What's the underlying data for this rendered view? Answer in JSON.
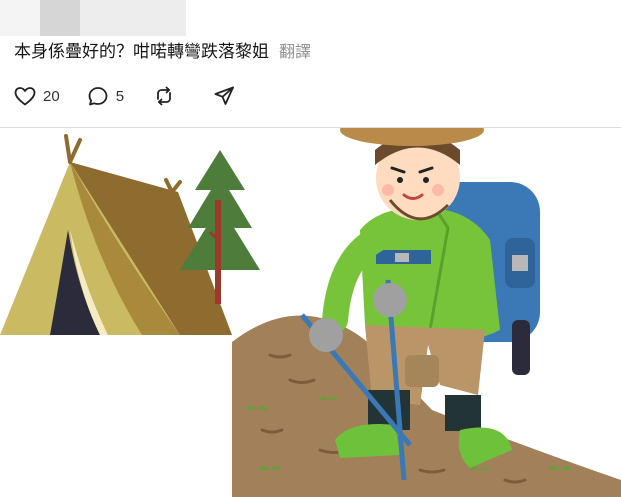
{
  "post": {
    "text": "本身係疊好的？咁喏轉彎跌落黎姐",
    "translate_label": "翻譯"
  },
  "actions": {
    "like_count": "20",
    "comment_count": "5"
  },
  "icons": {
    "like": "heart-icon",
    "comment": "comment-bubble-icon",
    "repost": "repost-icon",
    "share": "send-icon"
  },
  "colors": {
    "text": "#161616",
    "translate": "#8f8f8f",
    "divider": "#dcdcdc"
  }
}
